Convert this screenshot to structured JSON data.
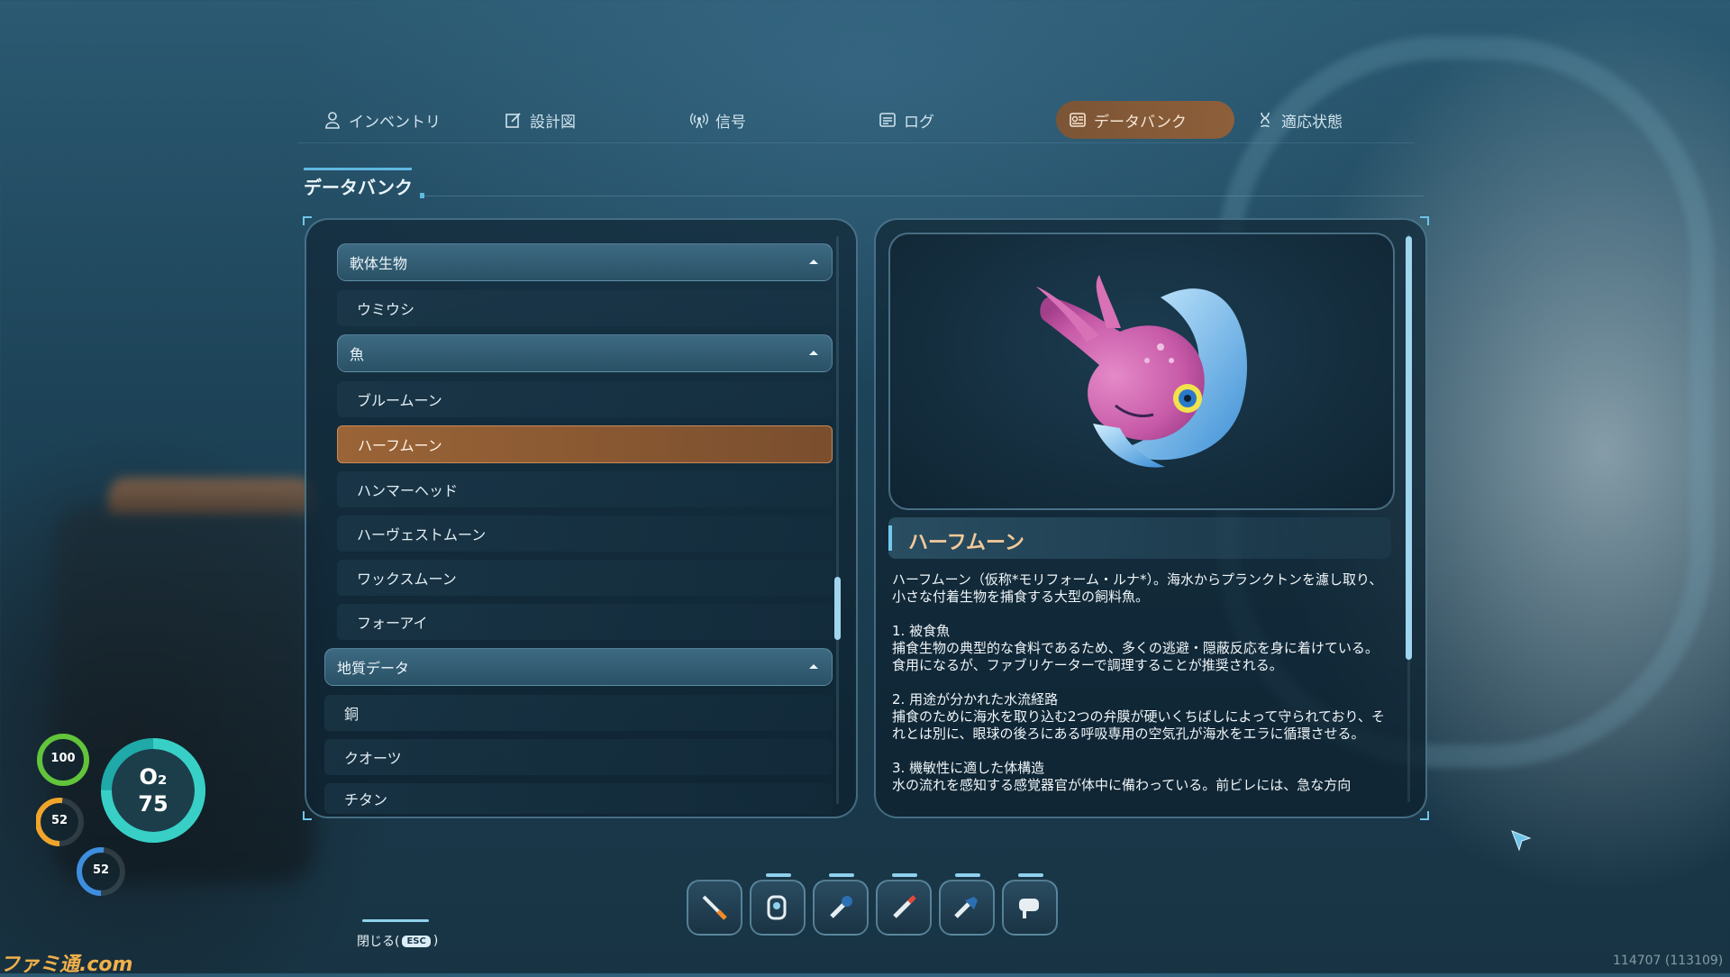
{
  "tabs": [
    {
      "label": "インベントリ",
      "icon": "person-icon"
    },
    {
      "label": "設計図",
      "icon": "blueprint-icon"
    },
    {
      "label": "信号",
      "icon": "signal-icon"
    },
    {
      "label": "ログ",
      "icon": "log-icon"
    },
    {
      "label": "データバンク",
      "icon": "databank-icon",
      "active": true
    },
    {
      "label": "適応状態",
      "icon": "dna-icon"
    }
  ],
  "section_title": "データバンク",
  "list": {
    "cat_mollusk": "軟体生物",
    "umiushi": "ウミウシ",
    "cat_fish": "魚",
    "bloomoon": "ブルームーン",
    "halfmoon": "ハーフムーン",
    "hammerhead": "ハンマーヘッド",
    "harvestmoon": "ハーヴェストムーン",
    "waxmoon": "ワックスムーン",
    "foreye": "フォーアイ",
    "cat_geology": "地質データ",
    "copper": "銅",
    "quartz": "クオーツ",
    "titanium": "チタン"
  },
  "detail": {
    "title": "ハーフムーン",
    "intro": "ハーフムーン（仮称*モリフォーム・ルナ*）。海水からプランクトンを濾し取り、小さな付着生物を捕食する大型の飼料魚。",
    "h1": "1. 被食魚",
    "p1": "捕食生物の典型的な食料であるため、多くの逃避・隠蔽反応を身に着けている。食用になるが、ファブリケーターで調理することが推奨される。",
    "h2": "2. 用途が分かれた水流経路",
    "p2": "捕食のために海水を取り込む2つの弁膜が硬いくちばしによって守られており、それとは別に、眼球の後ろにある呼吸専用の空気孔が海水をエラに循環させる。",
    "h3": "3. 機敏性に適した体構造",
    "p3": "水の流れを感知する感覚器官が体中に備わっている。前ビレには、急な方向"
  },
  "hud": {
    "health": "100",
    "food": "52",
    "water": "52",
    "oxygen_label": "O₂",
    "oxygen_value": "75",
    "health_level": 1.0,
    "food_level": 0.52,
    "water_level": 0.52,
    "oxygen_level": 0.75
  },
  "toolbar": [
    {
      "name": "survival-knife-icon"
    },
    {
      "name": "scanner-icon"
    },
    {
      "name": "repair-tool-icon"
    },
    {
      "name": "flare-icon"
    },
    {
      "name": "builder-tool-icon"
    },
    {
      "name": "propulsion-cannon-icon"
    }
  ],
  "close_label": "閉じる(",
  "close_key": "ESC",
  "close_tail": ")",
  "watermark": "ファミ通.com",
  "counter": "114707 (113109)",
  "colors": {
    "accent": "#5fb8df",
    "selected": "#9a6437",
    "title": "#f4c99a"
  }
}
